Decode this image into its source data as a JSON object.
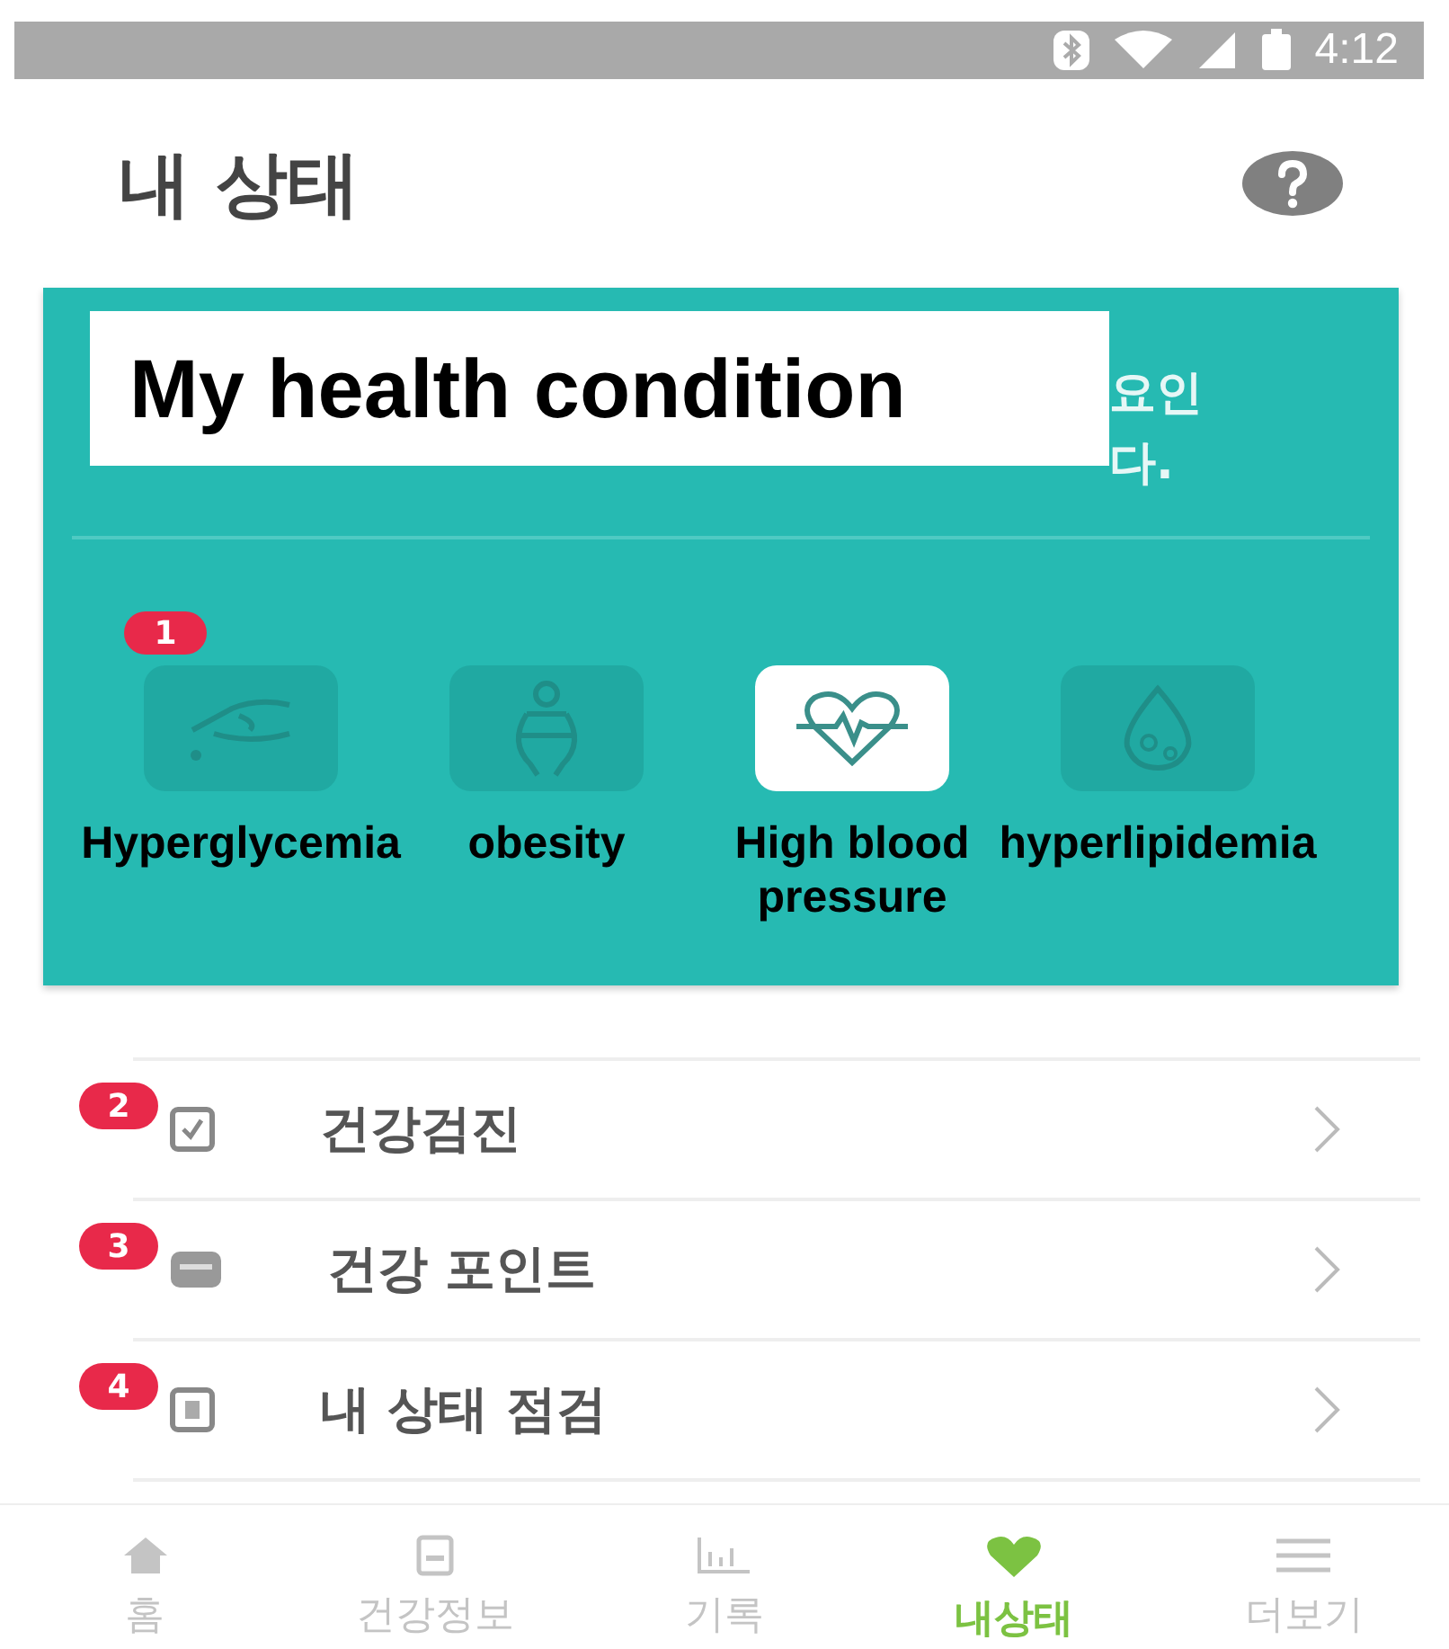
{
  "status_bar": {
    "time": "4:12"
  },
  "header": {
    "title": "내 상태"
  },
  "card": {
    "overlay_title": "My health condition",
    "message_fragments": [
      "요인",
      "다."
    ],
    "badge": "1",
    "categories": [
      {
        "label": "Hyperglycemia",
        "kind": "glucose",
        "selected": false
      },
      {
        "label": "obesity",
        "kind": "obesity",
        "selected": false
      },
      {
        "label": "High blood pressure",
        "kind": "heart",
        "selected": true
      },
      {
        "label": "hyperlipidemia",
        "kind": "lipid",
        "selected": false
      }
    ]
  },
  "menu": [
    {
      "badge": "2",
      "label": "건강검진",
      "kind": "checkup"
    },
    {
      "badge": "3",
      "label": "건강 포인트",
      "kind": "points"
    },
    {
      "badge": "4",
      "label": "내 상태 점검",
      "kind": "list"
    }
  ],
  "tabs": [
    {
      "label": "홈",
      "kind": "home",
      "selected": false
    },
    {
      "label": "건강정보",
      "kind": "info",
      "selected": false
    },
    {
      "label": "기록",
      "kind": "chart",
      "selected": false
    },
    {
      "label": "내상태",
      "kind": "heart",
      "selected": true
    },
    {
      "label": "더보기",
      "kind": "more",
      "selected": false
    }
  ]
}
